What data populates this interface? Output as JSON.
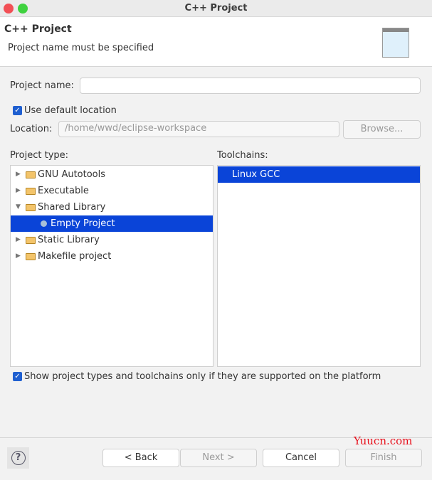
{
  "window": {
    "title": "C++ Project"
  },
  "header": {
    "title": "C++ Project",
    "message": "Project name must be specified"
  },
  "form": {
    "project_name_label": "Project name:",
    "project_name_value": "",
    "use_default_label": "Use default location",
    "use_default_checked": true,
    "location_label": "Location:",
    "location_value": "/home/wwd/eclipse-workspace",
    "browse_label": "Browse..."
  },
  "project_type": {
    "label": "Project type:",
    "items": [
      {
        "label": "GNU Autotools",
        "expanded": false
      },
      {
        "label": "Executable",
        "expanded": false
      },
      {
        "label": "Shared Library",
        "expanded": true
      },
      {
        "label": "Empty Project",
        "child": true,
        "selected": true
      },
      {
        "label": "Static Library",
        "expanded": false
      },
      {
        "label": "Makefile project",
        "expanded": false
      }
    ]
  },
  "toolchains": {
    "label": "Toolchains:",
    "items": [
      {
        "label": "Linux GCC",
        "selected": true
      }
    ]
  },
  "show_supported": {
    "label": "Show project types and toolchains only if they are supported on the platform",
    "checked": true
  },
  "buttons": {
    "help": "?",
    "back": "< Back",
    "next": "Next >",
    "cancel": "Cancel",
    "finish": "Finish"
  },
  "watermark": "Yuucn.com",
  "colors": {
    "selection": "#0a44d8",
    "checkbox": "#1f5fd0",
    "close": "#f25056",
    "zoom": "#3fd23f"
  }
}
